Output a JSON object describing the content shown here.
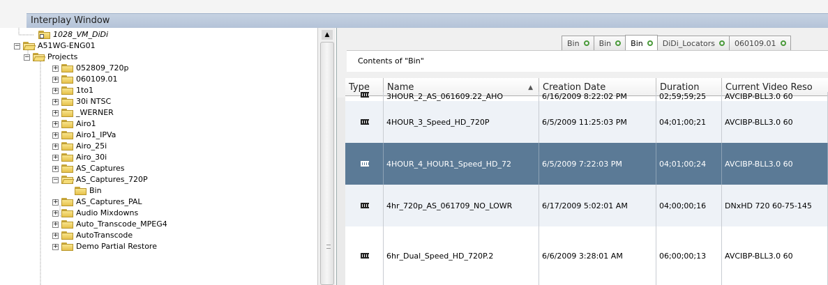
{
  "window": {
    "title": "Interplay Window"
  },
  "tree": {
    "items": [
      {
        "label": "1028_VM_DiDi",
        "icon": "shortcut-folder-icon",
        "italic": true,
        "expander": ""
      },
      {
        "label": "A51WG-ENG01",
        "icon": "folder-open-icon",
        "expander": "−"
      },
      {
        "label": "Projects",
        "icon": "folder-open-icon",
        "expander": "−"
      },
      {
        "label": "052809_720p",
        "icon": "folder-icon",
        "expander": "+"
      },
      {
        "label": "060109.01",
        "icon": "folder-icon",
        "expander": "+"
      },
      {
        "label": "1to1",
        "icon": "folder-icon",
        "expander": "+"
      },
      {
        "label": "30i NTSC",
        "icon": "folder-icon",
        "expander": "+"
      },
      {
        "label": "_WERNER",
        "icon": "folder-icon",
        "expander": "+"
      },
      {
        "label": "Airo1",
        "icon": "folder-icon",
        "expander": "+"
      },
      {
        "label": "Airo1_IPVa",
        "icon": "folder-icon",
        "expander": "+"
      },
      {
        "label": "Airo_25i",
        "icon": "folder-icon",
        "expander": "+"
      },
      {
        "label": "Airo_30i",
        "icon": "folder-icon",
        "expander": "+"
      },
      {
        "label": "AS_Captures",
        "icon": "folder-icon",
        "expander": "+"
      },
      {
        "label": "AS_Captures_720P",
        "icon": "folder-open-icon",
        "expander": "−"
      },
      {
        "label": "Bin",
        "icon": "folder-icon",
        "expander": ""
      },
      {
        "label": "AS_Captures_PAL",
        "icon": "folder-icon",
        "expander": "+"
      },
      {
        "label": "Audio Mixdowns",
        "icon": "folder-icon",
        "expander": "+"
      },
      {
        "label": "Auto_Transcode_MPEG4",
        "icon": "folder-icon",
        "expander": "+"
      },
      {
        "label": "AutoTranscode",
        "icon": "folder-icon",
        "expander": "+"
      },
      {
        "label": "Demo Partial Restore",
        "icon": "folder-icon",
        "expander": "+"
      }
    ]
  },
  "tabs": [
    {
      "label": "Bin",
      "active": false
    },
    {
      "label": "Bin",
      "active": false
    },
    {
      "label": "Bin",
      "active": true
    },
    {
      "label": "DiDi_Locators",
      "active": false
    },
    {
      "label": "060109.01",
      "active": false
    }
  ],
  "contents": {
    "label": "Contents of \"Bin\""
  },
  "table": {
    "columns": [
      "Type",
      "Name",
      "Creation Date",
      "Duration",
      "Current Video Reso"
    ],
    "rows": [
      {
        "type_icon": "clip-icon",
        "name": "3HOUR_2_AS_061609.22_AHO",
        "created": "6/16/2009 8:22:02 PM",
        "duration": "02;59;59;25",
        "resolution": "AVCIBP-BLL3.0 60"
      },
      {
        "type_icon": "clip-icon",
        "name": "4HOUR_3_Speed_HD_720P",
        "created": "6/5/2009 11:25:03 PM",
        "duration": "04;01;00;21",
        "resolution": "AVCIBP-BLL3.0 60"
      },
      {
        "type_icon": "clip-icon",
        "name": "4HOUR_4_HOUR1_Speed_HD_72",
        "created": "6/5/2009 7:22:03 PM",
        "duration": "04;01;00;24",
        "resolution": "AVCIBP-BLL3.0 60"
      },
      {
        "type_icon": "clip-icon",
        "name": "4hr_720p_AS_061709_NO_LOWR",
        "created": "6/17/2009 5:02:01 AM",
        "duration": "04;00;00;16",
        "resolution": "DNxHD 720 60-75-145"
      },
      {
        "type_icon": "clip-icon",
        "name": "6hr_Dual_Speed_HD_720P.2",
        "created": "6/6/2009 3:28:01 AM",
        "duration": "06;00;00;13",
        "resolution": "AVCIBP-BLL3.0 60"
      }
    ],
    "selected_row_index": 2
  }
}
